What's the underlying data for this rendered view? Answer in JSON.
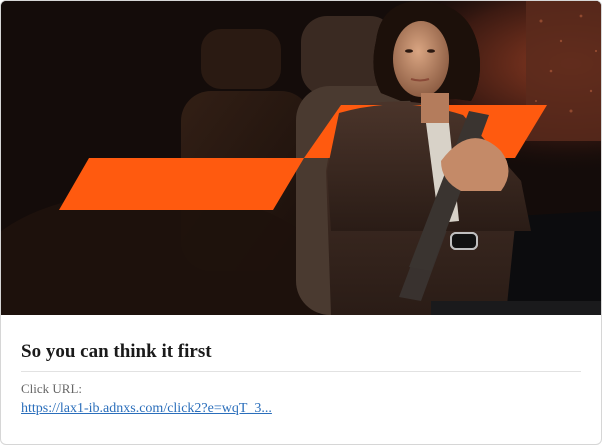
{
  "ad": {
    "title": "So you can think it first",
    "click_url_label": "Click URL:",
    "click_url": "https://lax1-ib.adnxs.com/click2?e=wqT_3..."
  },
  "hero": {
    "accent_color": "#ff5a0f",
    "background_color": "#120c0a"
  },
  "colors": {
    "link": "#2a6ebb",
    "title": "#1a1a1a",
    "label": "#666666"
  }
}
